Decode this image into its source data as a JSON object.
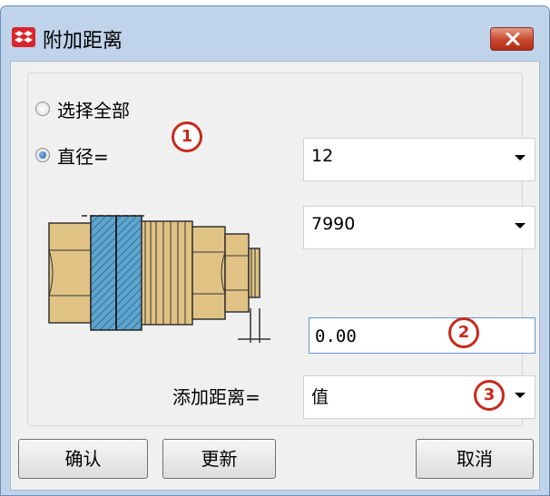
{
  "window": {
    "title": "附加距离",
    "close_icon": "close-icon"
  },
  "options": {
    "select_all_label": "选择全部",
    "diameter_label": "直径="
  },
  "diameter_combo": {
    "value": "12"
  },
  "second_combo": {
    "value": "7990"
  },
  "distance_input": {
    "value": "0.00"
  },
  "add_distance": {
    "label": "添加距离=",
    "value": "值"
  },
  "badges": [
    "1",
    "2",
    "3"
  ],
  "buttons": {
    "confirm": "确认",
    "update": "更新",
    "cancel": "取消"
  },
  "colors": {
    "accent": "#c8291c",
    "title_bg": "#bfd3ea",
    "close_button": "#c9452d",
    "bolt_gold": "#e0c384",
    "plate_blue": "#5fa6cf"
  }
}
